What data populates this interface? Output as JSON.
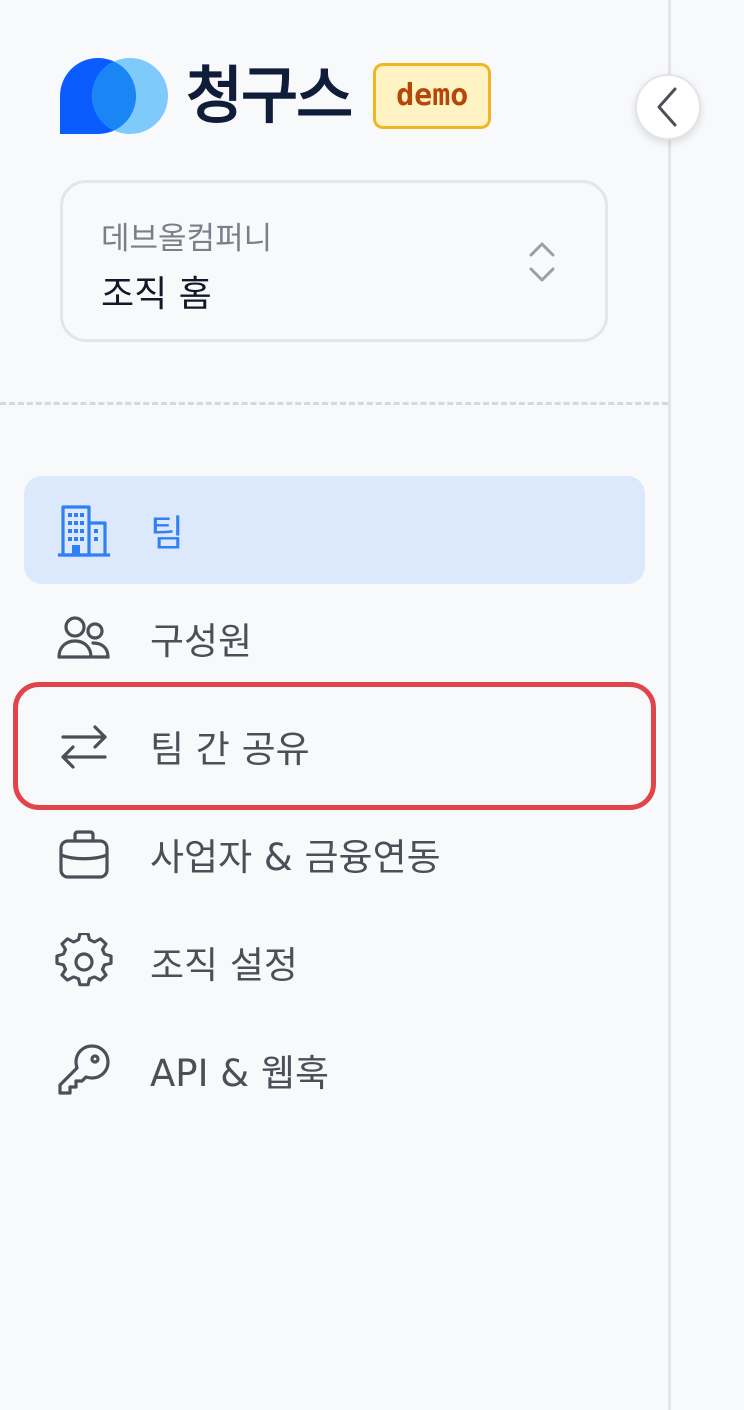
{
  "brand": {
    "name": "청구스",
    "badge": "demo",
    "logo_icon": "dual-circle-logo-icon"
  },
  "collapse_button": {
    "icon": "chevron-left-icon"
  },
  "org_selector": {
    "org_name": "데브올컴퍼니",
    "current_page": "조직 홈",
    "icon": "chevron-up-down-icon"
  },
  "nav": {
    "items": [
      {
        "label": "팀",
        "icon": "building-icon",
        "active": true
      },
      {
        "label": "구성원",
        "icon": "users-icon",
        "active": false
      },
      {
        "label": "팀 간 공유",
        "icon": "arrows-left-right-icon",
        "active": false,
        "highlighted": true
      },
      {
        "label": "사업자 & 금융연동",
        "icon": "briefcase-icon",
        "active": false
      },
      {
        "label": "조직 설정",
        "icon": "gear-icon",
        "active": false
      },
      {
        "label": "API & 웹훅",
        "icon": "key-icon",
        "active": false
      }
    ]
  },
  "colors": {
    "accent": "#2f7ff5",
    "active_bg": "#dce8fc",
    "highlight": "#e0454b",
    "badge_bg": "#fff3c4",
    "badge_border": "#f2b622",
    "badge_text": "#b54708"
  }
}
